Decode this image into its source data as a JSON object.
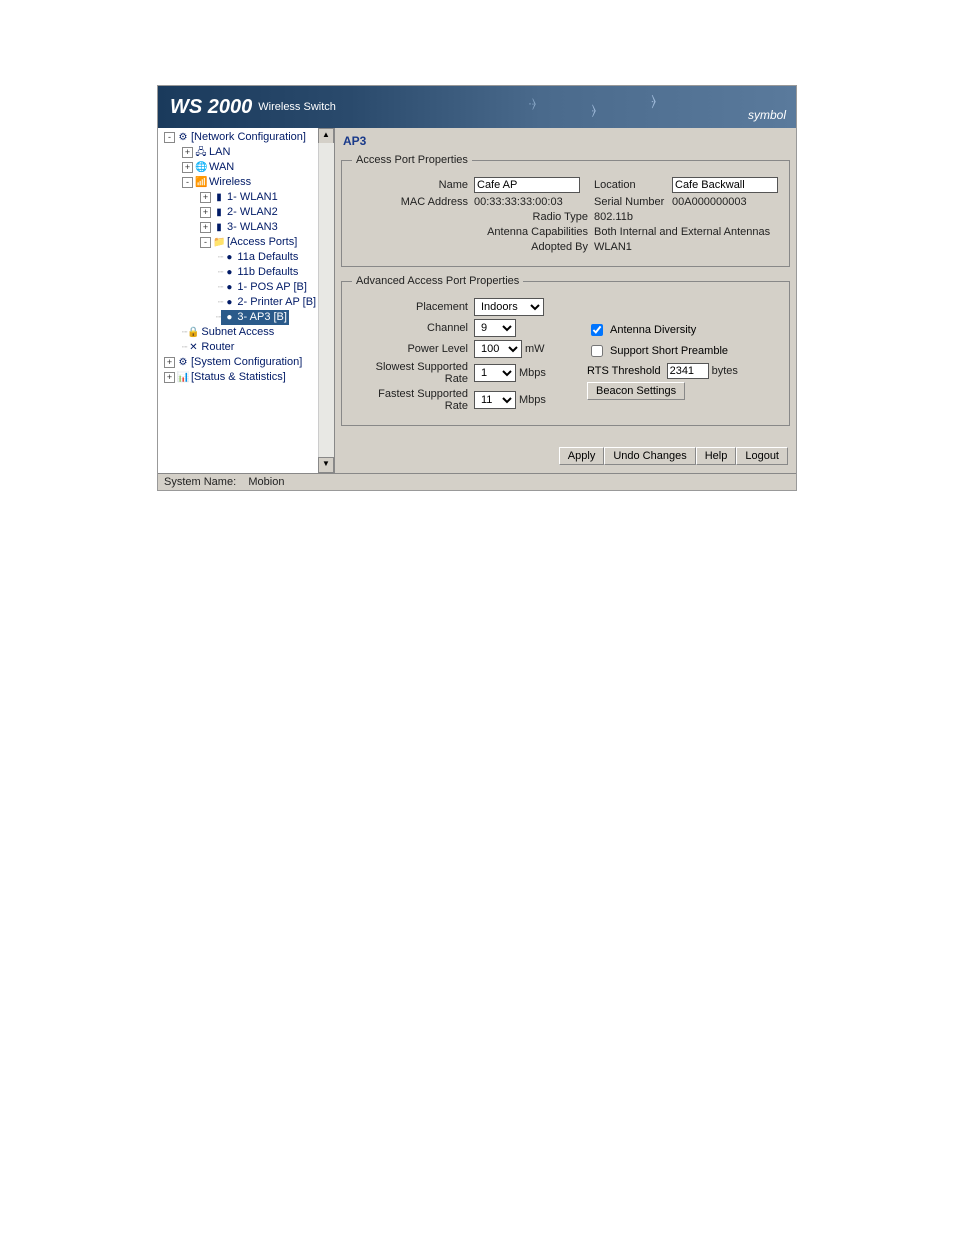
{
  "header": {
    "product": "WS 2000",
    "subtitle": "Wireless Switch",
    "brand": "symbol"
  },
  "tree": {
    "network_config": "[Network Configuration]",
    "lan": "LAN",
    "wan": "WAN",
    "wireless": "Wireless",
    "wlan1": "1- WLAN1",
    "wlan2": "2- WLAN2",
    "wlan3": "3- WLAN3",
    "access_ports": "[Access Ports]",
    "defaults_11a": "11a Defaults",
    "defaults_11b": "11b Defaults",
    "pos_ap": "1- POS AP [B]",
    "printer_ap": "2- Printer AP [B]",
    "ap3": "3- AP3 [B]",
    "subnet_access": "Subnet Access",
    "router": "Router",
    "system_config": "[System Configuration]",
    "status_stats": "[Status & Statistics]"
  },
  "page": {
    "title": "AP3",
    "props_legend": "Access Port Properties",
    "adv_legend": "Advanced Access Port Properties",
    "name_label": "Name",
    "name_value": "Cafe AP",
    "location_label": "Location",
    "location_value": "Cafe Backwall",
    "mac_label": "MAC Address",
    "mac_value": "00:33:33:33:00:03",
    "serial_label": "Serial Number",
    "serial_value": "00A000000003",
    "radio_label": "Radio Type",
    "radio_value": "802.11b",
    "antenna_label": "Antenna Capabilities",
    "antenna_value": "Both Internal and External Antennas",
    "adopted_label": "Adopted By",
    "adopted_value": "WLAN1",
    "placement_label": "Placement",
    "placement_value": "Indoors",
    "channel_label": "Channel",
    "channel_value": "9",
    "power_label": "Power Level",
    "power_value": "100",
    "power_unit": "mW",
    "slowest_label": "Slowest Supported Rate",
    "slowest_value": "1",
    "fastest_label": "Fastest Supported Rate",
    "fastest_value": "11",
    "rate_unit": "Mbps",
    "antenna_div_label": "Antenna Diversity",
    "short_preamble_label": "Support Short Preamble",
    "rts_label": "RTS Threshold",
    "rts_value": "2341",
    "rts_unit": "bytes",
    "beacon_btn": "Beacon Settings"
  },
  "buttons": {
    "apply": "Apply",
    "undo": "Undo Changes",
    "help": "Help",
    "logout": "Logout"
  },
  "statusbar": {
    "system_name_label": "System Name:",
    "system_name_value": "Mobion"
  }
}
